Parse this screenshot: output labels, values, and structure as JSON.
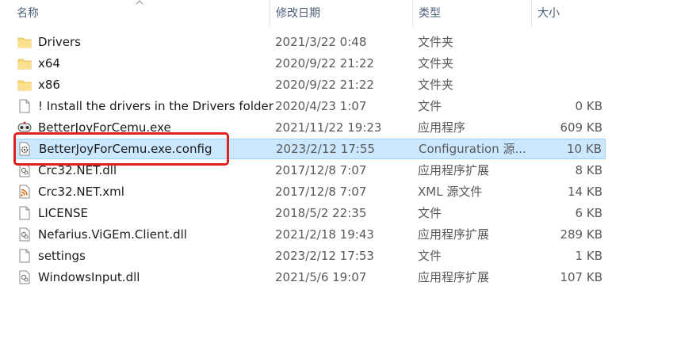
{
  "header": {
    "name": "名称",
    "date": "修改日期",
    "type": "类型",
    "size": "大小"
  },
  "files": [
    {
      "name": "Drivers",
      "date": "2021/3/22 0:48",
      "type": "文件夹",
      "size": "",
      "icon": "folder-icon"
    },
    {
      "name": "x64",
      "date": "2020/9/22 21:22",
      "type": "文件夹",
      "size": "",
      "icon": "folder-icon"
    },
    {
      "name": "x86",
      "date": "2020/9/22 21:22",
      "type": "文件夹",
      "size": "",
      "icon": "folder-icon"
    },
    {
      "name": "! Install the drivers in the Drivers folder",
      "date": "2020/4/23 1:07",
      "type": "文件",
      "size": "0 KB",
      "icon": "file-icon"
    },
    {
      "name": "BetterJoyForCemu.exe",
      "date": "2021/11/22 19:23",
      "type": "应用程序",
      "size": "609 KB",
      "icon": "gamepad-app-icon"
    },
    {
      "name": "BetterJoyForCemu.exe.config",
      "date": "2023/2/12 17:55",
      "type": "Configuration 源...",
      "size": "10 KB",
      "icon": "config-gear-icon",
      "selected": true
    },
    {
      "name": "Crc32.NET.dll",
      "date": "2017/12/8 7:07",
      "type": "应用程序扩展",
      "size": "8 KB",
      "icon": "dll-icon"
    },
    {
      "name": "Crc32.NET.xml",
      "date": "2017/12/8 7:07",
      "type": "XML 源文件",
      "size": "14 KB",
      "icon": "xml-rss-icon"
    },
    {
      "name": "LICENSE",
      "date": "2018/5/2 22:35",
      "type": "文件",
      "size": "6 KB",
      "icon": "file-icon"
    },
    {
      "name": "Nefarius.ViGEm.Client.dll",
      "date": "2021/2/18 19:43",
      "type": "应用程序扩展",
      "size": "289 KB",
      "icon": "dll-icon"
    },
    {
      "name": "settings",
      "date": "2023/2/12 17:53",
      "type": "文件",
      "size": "1 KB",
      "icon": "file-icon"
    },
    {
      "name": "WindowsInput.dll",
      "date": "2021/5/6 19:07",
      "type": "应用程序扩展",
      "size": "107 KB",
      "icon": "dll-icon"
    }
  ],
  "colors": {
    "selection_bg": "#cce8ff",
    "selection_border": "#99d1ff",
    "highlight": "#e02020",
    "folder": "#f8d775"
  }
}
